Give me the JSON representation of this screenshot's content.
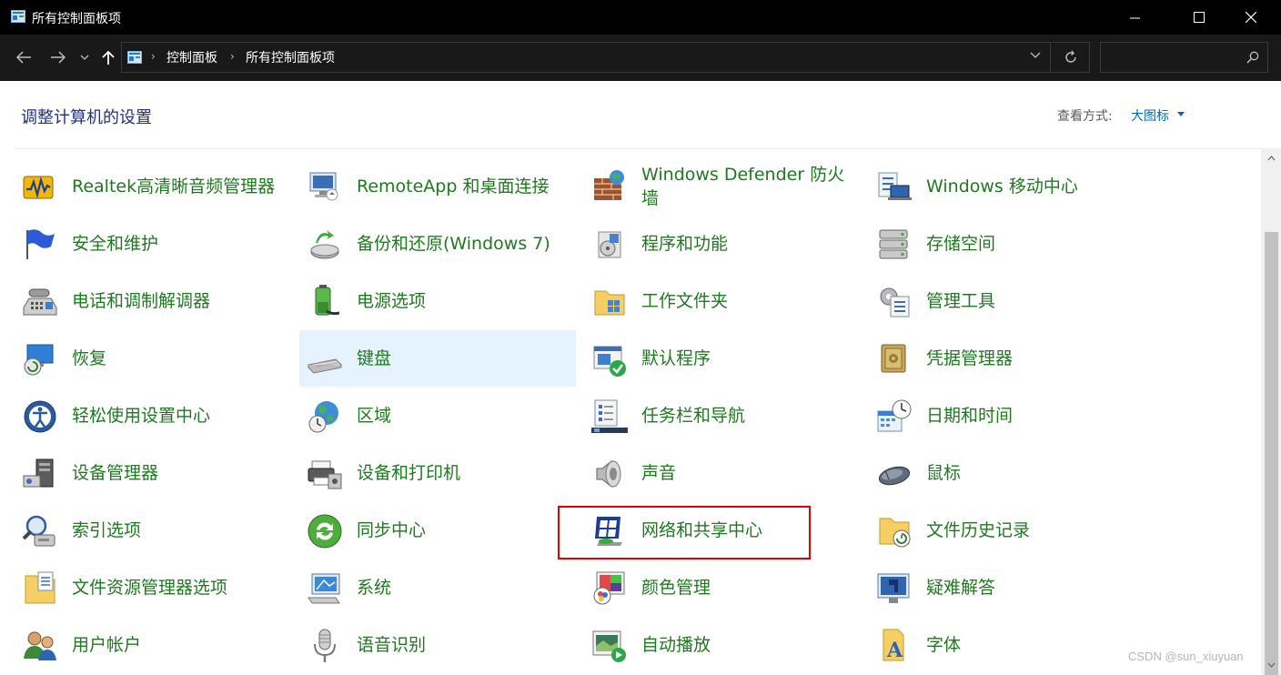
{
  "window": {
    "title": "所有控制面板项"
  },
  "nav": {
    "breadcrumb": [
      "控制面板",
      "所有控制面板项"
    ],
    "search_placeholder": ""
  },
  "header": {
    "title": "调整计算机的设置",
    "view_by_label": "查看方式:",
    "view_by_value": "大图标"
  },
  "items": [
    {
      "label": "Realtek高清晰音频管理器",
      "icon": "audio-manager-icon"
    },
    {
      "label": "RemoteApp 和桌面连接",
      "icon": "remote-desktop-icon"
    },
    {
      "label": "Windows Defender 防火墙",
      "icon": "firewall-icon"
    },
    {
      "label": "Windows 移动中心",
      "icon": "mobility-center-icon"
    },
    {
      "label": "安全和维护",
      "icon": "security-flag-icon"
    },
    {
      "label": "备份和还原(Windows 7)",
      "icon": "backup-icon"
    },
    {
      "label": "程序和功能",
      "icon": "programs-icon"
    },
    {
      "label": "存储空间",
      "icon": "storage-icon"
    },
    {
      "label": "电话和调制解调器",
      "icon": "phone-modem-icon"
    },
    {
      "label": "电源选项",
      "icon": "power-icon"
    },
    {
      "label": "工作文件夹",
      "icon": "work-folder-icon"
    },
    {
      "label": "管理工具",
      "icon": "admin-tools-icon"
    },
    {
      "label": "恢复",
      "icon": "recovery-icon"
    },
    {
      "label": "键盘",
      "icon": "keyboard-icon"
    },
    {
      "label": "默认程序",
      "icon": "default-programs-icon"
    },
    {
      "label": "凭据管理器",
      "icon": "credential-icon"
    },
    {
      "label": "轻松使用设置中心",
      "icon": "ease-of-access-icon"
    },
    {
      "label": "区域",
      "icon": "region-icon"
    },
    {
      "label": "任务栏和导航",
      "icon": "taskbar-icon"
    },
    {
      "label": "日期和时间",
      "icon": "datetime-icon"
    },
    {
      "label": "设备管理器",
      "icon": "device-manager-icon"
    },
    {
      "label": "设备和打印机",
      "icon": "printer-icon"
    },
    {
      "label": "声音",
      "icon": "sound-icon"
    },
    {
      "label": "鼠标",
      "icon": "mouse-icon"
    },
    {
      "label": "索引选项",
      "icon": "indexing-icon"
    },
    {
      "label": "同步中心",
      "icon": "sync-icon"
    },
    {
      "label": "网络和共享中心",
      "icon": "network-icon"
    },
    {
      "label": "文件历史记录",
      "icon": "file-history-icon"
    },
    {
      "label": "文件资源管理器选项",
      "icon": "explorer-options-icon"
    },
    {
      "label": "系统",
      "icon": "system-icon"
    },
    {
      "label": "颜色管理",
      "icon": "color-management-icon"
    },
    {
      "label": "疑难解答",
      "icon": "troubleshoot-icon"
    },
    {
      "label": "用户帐户",
      "icon": "user-accounts-icon"
    },
    {
      "label": "语音识别",
      "icon": "microphone-icon"
    },
    {
      "label": "自动播放",
      "icon": "autoplay-icon"
    },
    {
      "label": "字体",
      "icon": "fonts-icon"
    }
  ],
  "selected_item": "键盘",
  "highlighted_item": "网络和共享中心",
  "watermark": "CSDN @sun_xiuyuan",
  "colors": {
    "link_green": "#1f7a1f",
    "title_blue": "#1e3287",
    "selection": "#e5f3ff",
    "highlight_red": "#e60000"
  }
}
